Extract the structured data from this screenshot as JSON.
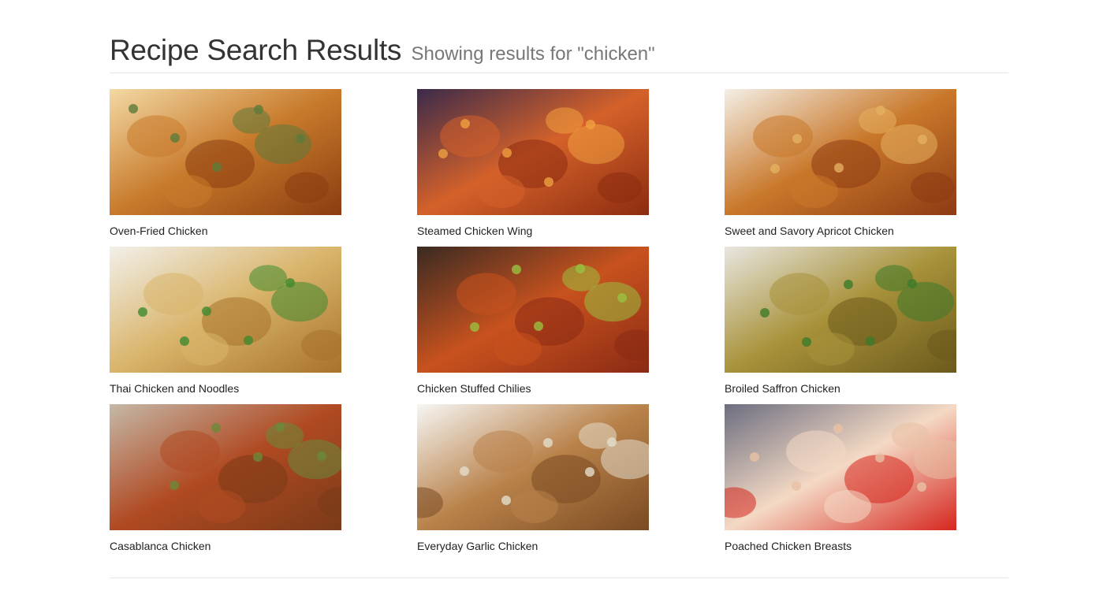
{
  "header": {
    "title": "Recipe Search Results",
    "subtitle": "Showing results for \"chicken\""
  },
  "results": [
    {
      "name": "Oven-Fried Chicken",
      "palette": [
        "#f3d9a4",
        "#c87a2b",
        "#8a3d10",
        "#5d7a3a"
      ]
    },
    {
      "name": "Steamed Chicken Wing",
      "palette": [
        "#3b2a4a",
        "#d4612a",
        "#8c2c10",
        "#f0a040"
      ]
    },
    {
      "name": "Sweet and Savory Apricot Chicken",
      "palette": [
        "#f4efe6",
        "#c9782a",
        "#8e3a14",
        "#e5b060"
      ]
    },
    {
      "name": "Thai Chicken and Noodles",
      "palette": [
        "#f2f0ea",
        "#d9b46a",
        "#a8722c",
        "#3e8a2e"
      ]
    },
    {
      "name": "Chicken Stuffed Chilies",
      "palette": [
        "#3a2a22",
        "#c8521e",
        "#8a2a14",
        "#9ac040"
      ]
    },
    {
      "name": "Broiled Saffron Chicken",
      "palette": [
        "#e8e6e0",
        "#a8923a",
        "#6b5a1c",
        "#3c7a2a"
      ]
    },
    {
      "name": "Casablanca Chicken",
      "palette": [
        "#c5b8a8",
        "#b04a22",
        "#7a3a18",
        "#6a8a3a"
      ]
    },
    {
      "name": "Everyday Garlic Chicken",
      "palette": [
        "#f6f6f4",
        "#b9824a",
        "#7a4a22",
        "#e4ddcc"
      ]
    },
    {
      "name": "Poached Chicken Breasts",
      "palette": [
        "#6c6e80",
        "#f4d9c4",
        "#d6261e",
        "#e8c0a4"
      ]
    }
  ]
}
